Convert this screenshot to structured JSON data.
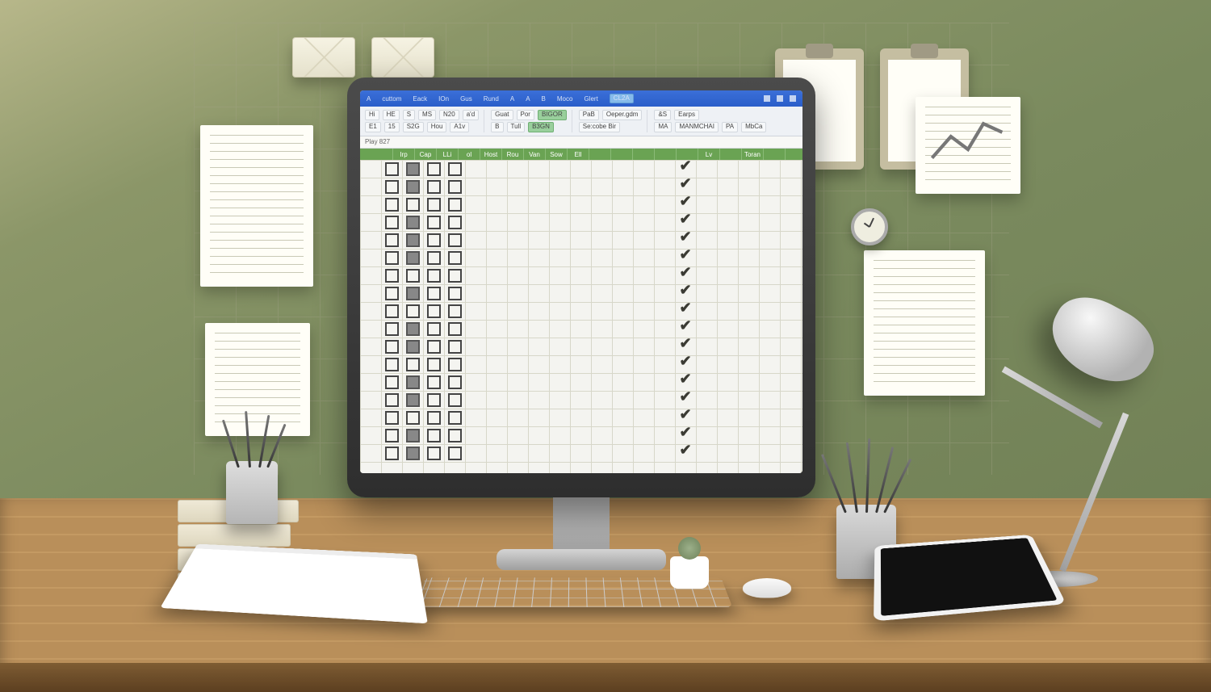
{
  "titlebar": {
    "items": [
      "A",
      "cuttom",
      "Eack",
      "IOn",
      "Gus",
      "Rund",
      "A",
      "A",
      "B",
      "Moco",
      "Glert"
    ],
    "accent": "CL2A"
  },
  "ribbon": {
    "g1": [
      "Hi",
      "HE",
      "S",
      "MS",
      "N20",
      "a'd",
      "E1",
      "15",
      "S2G",
      "Hou",
      "A1v"
    ],
    "g2": [
      "Guat",
      "Por",
      "B",
      "BIGOR",
      "Tull",
      "B3GN"
    ],
    "g3": [
      "PaB",
      "Oeper.gdm",
      "Se:cobe Bir"
    ],
    "g4": [
      "&S",
      "MA",
      "Earps",
      "MANMCHAI",
      "PA",
      "MbCa"
    ]
  },
  "namebox": "Play 827",
  "columns": [
    "",
    "Irp",
    "Cap",
    "LLi",
    "ol",
    "Host",
    "Rou",
    "Van",
    "Sow",
    "Ell",
    "",
    "",
    "",
    "",
    "",
    "Lv",
    "",
    "Toran",
    "",
    ""
  ],
  "col2Filled": [
    true,
    true,
    false,
    true,
    true,
    true,
    false,
    true,
    false,
    true,
    true,
    false,
    true,
    true,
    false,
    true,
    true
  ],
  "checkRows": 17
}
